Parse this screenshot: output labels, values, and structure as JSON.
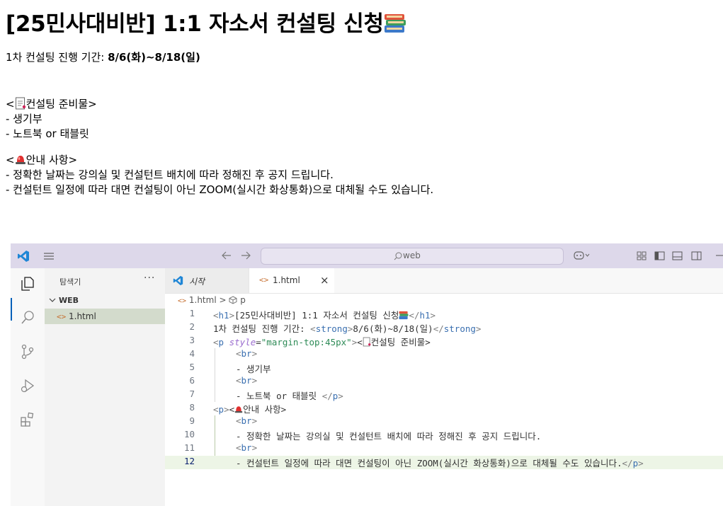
{
  "page": {
    "title": "[25민사대비반] 1:1 자소서 컨설팅 신청",
    "period_label": "1차 컨설팅 진행 기간: ",
    "period_value": "8/6(화)~8/18(일)",
    "prep_open": "<",
    "prep_title": "컨설팅 준비물>",
    "prep_items": [
      "- 생기부",
      "- 노트북 or 태블릿"
    ],
    "notice_open": "<",
    "notice_title": "안내 사항>",
    "notice_items": [
      "- 정확한 날짜는 강의실 및 컨설턴트 배치에 따라 정해진 후 공지 드립니다.",
      "- 컨설턴트 일정에 따라 대면 컨설팅이 아닌 ZOOM(실시간 화상통화)으로 대체될 수도 있습니다."
    ]
  },
  "vscode": {
    "search_placeholder": "web",
    "explorer_title": "탐색기",
    "explorer_more": "···",
    "folder_name": "WEB",
    "file_name": "1.html",
    "tabs": [
      {
        "label": "시작"
      },
      {
        "label": "1.html",
        "close": "×"
      }
    ],
    "breadcrumb_file": "1.html",
    "breadcrumb_sep": ">",
    "breadcrumb_elem": "p",
    "line_numbers": [
      "1",
      "2",
      "3",
      "4",
      "5",
      "6",
      "7",
      "8",
      "9",
      "10",
      "11",
      "12"
    ],
    "code": {
      "l1_text": "[25민사대비반] 1:1 자소서 컨설팅 신청",
      "l2_text1": "1차 컨설팅 진행 기간: ",
      "l2_text2": "8/6(화)~8/18(일)",
      "l3_attr": "style",
      "l3_val": "\"margin-top:45px\"",
      "l3_text": "컨설팅 준비물>",
      "l5_text": "- 생기부",
      "l7_text": "- 노트북 or 태블릿 ",
      "l8_text": "안내 사항>",
      "l10_text": "- 정확한 날짜는 강의실 및 컨설턴트 배치에 따라 정해진 후 공지 드립니다.",
      "l12_text": "- 컨설턴트 일정에 따라 대면 컨설팅이 아닌 ZOOM(실시간 화상통화)으로 대체될 수도 있습니다."
    }
  },
  "colors": {
    "titlebar": "#ddd8ea",
    "tag_name": "#3a6fb0",
    "attr_value": "#2e8b57",
    "highlight_line": "#edf5e6"
  }
}
